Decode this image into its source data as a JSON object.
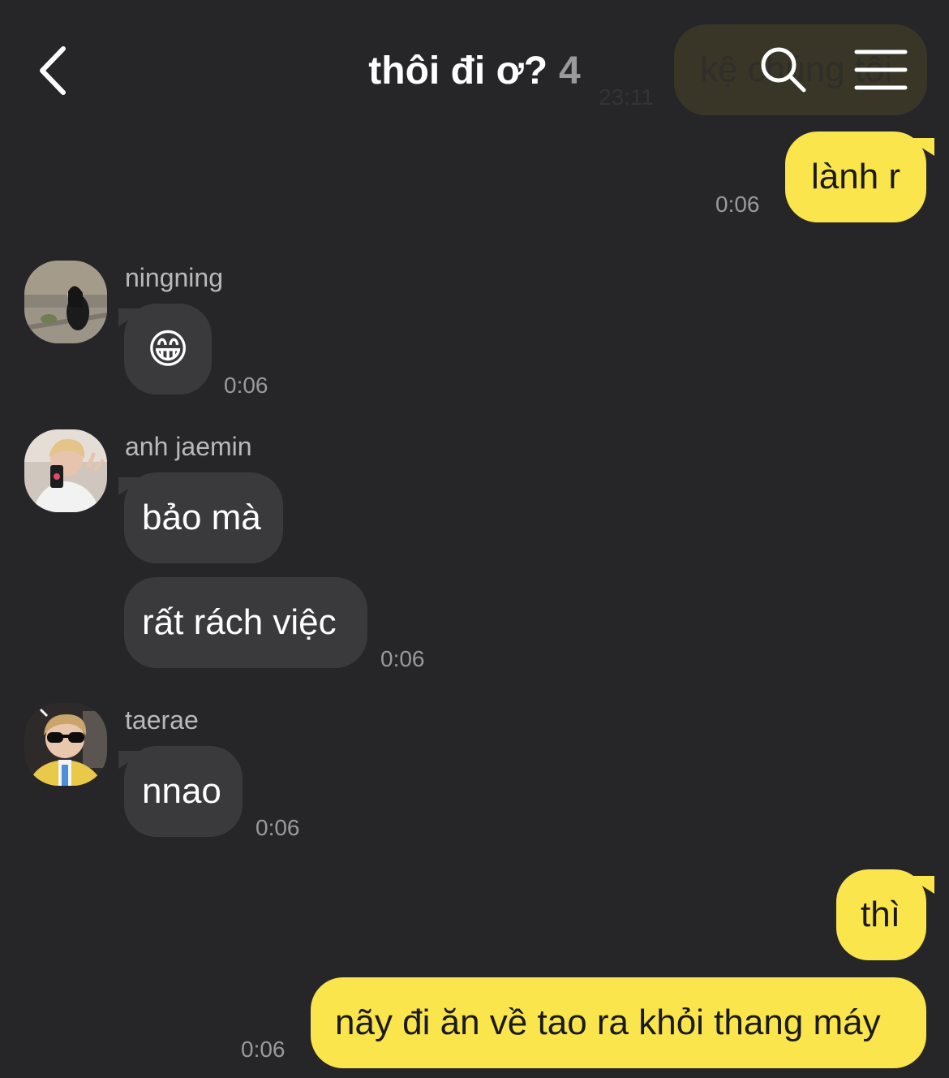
{
  "header": {
    "title": "thôi đi ơ?",
    "member_count": "4"
  },
  "ghost": {
    "text": "kệ chúng tôi",
    "time": "23:11"
  },
  "messages": [
    {
      "text": "lành r",
      "time": "0:06"
    },
    {
      "sender": "ningning",
      "emoji": "😁",
      "time": "0:06"
    },
    {
      "sender": "anh jaemin",
      "text": "bảo mà"
    },
    {
      "text": "rất rách việc",
      "time": "0:06"
    },
    {
      "sender": "taerae",
      "text": "nnao",
      "time": "0:06"
    },
    {
      "text": "thì"
    },
    {
      "text": "nãy đi ăn về tao ra khỏi thang máy",
      "time": "0:06"
    }
  ],
  "colors": {
    "background": "#262628",
    "my_bubble": "#fae54d",
    "other_bubble": "#3a3a3c",
    "timestamp": "#9a9a9c"
  },
  "icons": {
    "back": "chevron-left-icon",
    "search": "search-icon",
    "menu": "hamburger-menu-icon"
  }
}
